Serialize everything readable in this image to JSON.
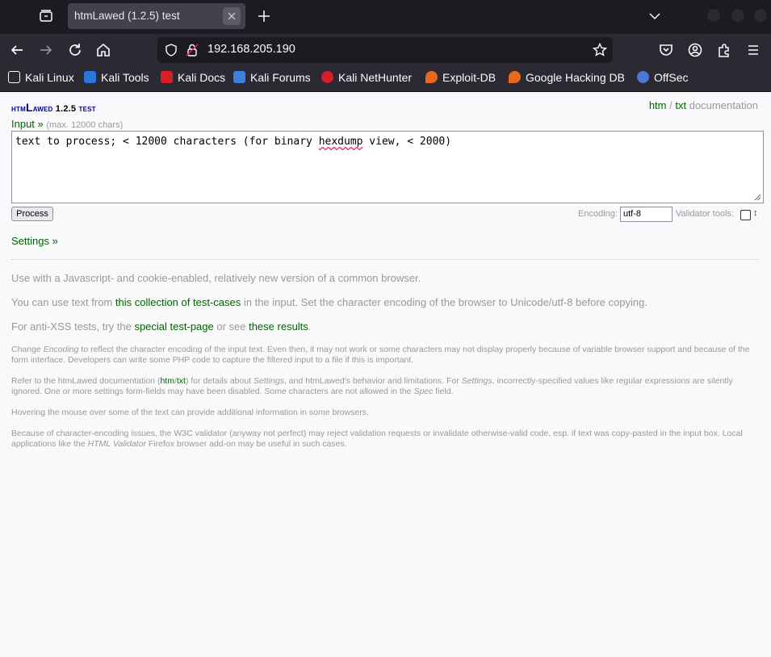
{
  "browser": {
    "tab_title": "htmLawed (1.2.5) test",
    "url": "192.168.205.190",
    "bookmarks": [
      {
        "label": "Kali Linux",
        "color": "#ffffff"
      },
      {
        "label": "Kali Tools",
        "color": "#2b77d9"
      },
      {
        "label": "Kali Docs",
        "color": "#d22128"
      },
      {
        "label": "Kali Forums",
        "color": "#3d7ee0"
      },
      {
        "label": "Kali NetHunter",
        "color": "#d22128"
      },
      {
        "label": "Exploit-DB",
        "color": "#e8691c"
      },
      {
        "label": "Google Hacking DB",
        "color": "#e8691c"
      },
      {
        "label": "OffSec",
        "color": "#4a78d6"
      }
    ]
  },
  "page": {
    "title_prefix": "htm",
    "title_big": "L",
    "title_rest": "awed",
    "title_version": "1.2.5",
    "title_suffix": "test",
    "doc_htm": "htm",
    "doc_sep": "/",
    "doc_txt": "txt",
    "doc_word": "documentation",
    "input_label": "Input »",
    "input_hint": "(max. 12000 chars)",
    "input_text_before": "text to process; < 12000 characters (for binary ",
    "input_text_misspelled": "hexdump",
    "input_text_after": " view, < 2000)",
    "process_button": "Process",
    "encoding_label": "Encoding:",
    "encoding_value": "utf-8",
    "validator_label": "Validator tools:",
    "validator_arrow": "↕",
    "settings_link": "Settings »",
    "p1": "Use with a Javascript- and cookie-enabled, relatively new version of a common browser.",
    "p2_a": "You can use text from ",
    "p2_link": "this collection of test-cases",
    "p2_b": " in the input. Set the character encoding of the browser to Unicode/utf-8 before copying.",
    "p3_a": "For anti-XSS tests, try the ",
    "p3_link1": "special test-page",
    "p3_b": " or see ",
    "p3_link2": "these results",
    "p3_c": ".",
    "n1_a": "Change ",
    "n1_em": "Encoding",
    "n1_b": " to reflect the character encoding of the input text. Even then, it may not work or some characters may not display properly because of variable browser support and because of the form interface. Developers can write some PHP code to capture the filtered input to a file if this is important.",
    "n2_a": "Refer to the htmLawed documentation (",
    "n2_htm": "htm",
    "n2_sep": "/",
    "n2_txt": "txt",
    "n2_b": ") for details about ",
    "n2_em1": "Settings",
    "n2_c": ", and htmLawed's behavior and limitations. For ",
    "n2_em2": "Settings",
    "n2_d": ", incorrectly-specified values like regular expressions are silently ignored. One or more settings form-fields may have been disabled. Some characters are not allowed in the ",
    "n2_em3": "Spec",
    "n2_e": " field.",
    "n3": "Hovering the mouse over some of the text can provide additional information in some browsers.",
    "n4_a": "Because of character-encoding issues, the W3C validator (anyway not perfect) may reject validation requests or invalidate otherwise-valid code, esp. if text was copy-pasted in the input box. Local applications like the ",
    "n4_em": "HTML Validator",
    "n4_b": " Firefox browser add-on may be useful in such cases."
  }
}
